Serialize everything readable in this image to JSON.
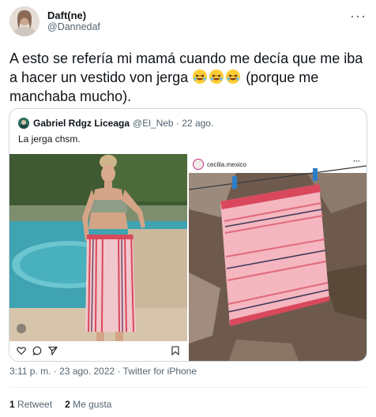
{
  "tweet": {
    "display_name": "Daft(ne)",
    "handle": "@Dannedaf",
    "text_before": "A esto se refería mi mamá cuando me decía que me iba a hacer un vestido von jerga",
    "emoji": "rolling-on-floor-laughing",
    "emoji_count": 3,
    "text_after": "(porque me manchaba mucho).",
    "timestamp": "3:11 p. m. · 23 ago. 2022 · Twitter for iPhone",
    "retweets_count": "1",
    "retweets_label": "Retweet",
    "likes_count": "2",
    "likes_label": "Me gusta",
    "more_icon": "more-icon"
  },
  "quote": {
    "display_name": "Gabriel Rdgz Liceaga",
    "handle": "@El_Neb",
    "date": "22 ago.",
    "text": "La jerga chsm.",
    "left_image": "woman wearing striped jerga cloth by pool",
    "right_account": "cecilia.mexico",
    "right_image": "striped red jerga cloth hanging on clothesline"
  },
  "colors": {
    "text": "#0f1419",
    "secondary": "#536471",
    "border": "#cfd9de",
    "jerga_red": "#d9485c",
    "jerga_pink": "#f2b8c0"
  }
}
